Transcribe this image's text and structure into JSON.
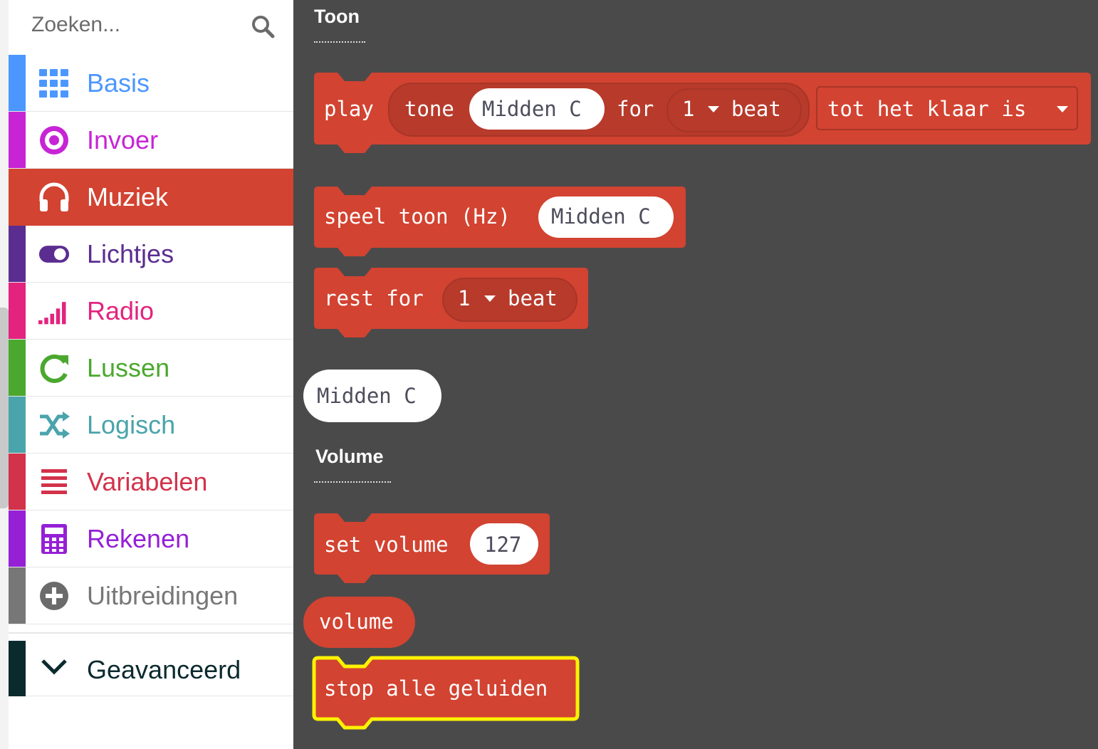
{
  "search": {
    "placeholder": "Zoeken..."
  },
  "categories": [
    {
      "label": "Basis",
      "color": "#4c97ff",
      "icon": "grid-icon"
    },
    {
      "label": "Invoer",
      "color": "#c724d6",
      "icon": "target-icon"
    },
    {
      "label": "Muziek",
      "color": "#d24331",
      "icon": "headphones-icon",
      "active": true
    },
    {
      "label": "Lichtjes",
      "color": "#5c2d91",
      "icon": "toggle-icon"
    },
    {
      "label": "Radio",
      "color": "#e3237e",
      "icon": "signal-bars-icon"
    },
    {
      "label": "Lussen",
      "color": "#4ba82e",
      "icon": "refresh-icon"
    },
    {
      "label": "Logisch",
      "color": "#4aa4ab",
      "icon": "shuffle-icon"
    },
    {
      "label": "Variabelen",
      "color": "#d3324b",
      "icon": "list-icon"
    },
    {
      "label": "Rekenen",
      "color": "#9520d6",
      "icon": "calculator-icon"
    },
    {
      "label": "Uitbreidingen",
      "color": "#777777",
      "icon": "plus-circle-icon"
    }
  ],
  "advanced": {
    "label": "Geavanceerd",
    "icon": "chevron-down-icon"
  },
  "workspace": {
    "toon_heading": "Toon",
    "volume_heading": "Volume",
    "play_block": {
      "play": "play",
      "tone": "tone",
      "note": "Midden C",
      "for": "for",
      "beats": "1",
      "beat": "beat",
      "mode": "tot het klaar is"
    },
    "ring_block": {
      "label": "speel toon (Hz)",
      "note": "Midden C"
    },
    "rest_block": {
      "rest_for": "rest for",
      "beats": "1",
      "beat": "beat"
    },
    "note_reporter": {
      "note": "Midden C"
    },
    "set_volume_block": {
      "label": "set volume",
      "value": "127"
    },
    "volume_reporter": {
      "label": "volume"
    },
    "stop_block": {
      "label": "stop alle geluiden"
    }
  },
  "colors": {
    "block": "#d24331",
    "block_dark": "#b73a2b",
    "workspace": "#4b4a4b",
    "highlight": "#fff200"
  }
}
